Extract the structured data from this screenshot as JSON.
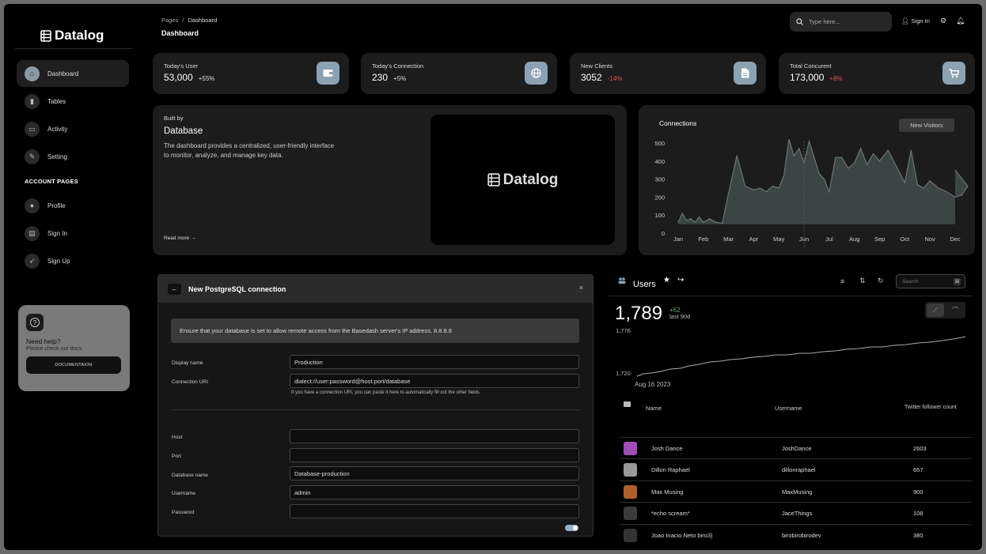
{
  "app": {
    "name": "Datalog"
  },
  "sidebar": {
    "items": [
      {
        "label": "Dashboard",
        "icon": "home-icon"
      },
      {
        "label": "Tables",
        "icon": "bar-chart-icon"
      },
      {
        "label": "Activity",
        "icon": "credit-card-icon"
      },
      {
        "label": "Setting",
        "icon": "wrench-icon"
      }
    ],
    "account_heading": "ACCOUNT PAGES",
    "account_items": [
      {
        "label": "Profile",
        "icon": "person-icon"
      },
      {
        "label": "Sign In",
        "icon": "document-icon"
      },
      {
        "label": "Sign Up",
        "icon": "rocket-icon"
      }
    ],
    "help": {
      "title": "Need help?",
      "subtitle": "Please check our docs",
      "button": "DOCUMENTAION"
    }
  },
  "header": {
    "breadcrumb_root": "Pages",
    "breadcrumb_sep": "/",
    "breadcrumb_current": "Dashboard",
    "title": "Dashboard",
    "search_placeholder": "Type here...",
    "sign_in": "Sign In"
  },
  "stats": [
    {
      "label": "Today's User",
      "value": "53,000",
      "change": "+55%",
      "color": "#dddddd",
      "icon": "wallet-icon"
    },
    {
      "label": "Today's Connection",
      "value": "230",
      "change": "+5%",
      "color": "#dddddd",
      "icon": "globe-icon"
    },
    {
      "label": "New Clients",
      "value": "3052",
      "change": "-14%",
      "color": "#e05252",
      "icon": "document-icon"
    },
    {
      "label": "Total Concurent",
      "value": "173,000",
      "change": "+8%",
      "color": "#e05252",
      "icon": "cart-icon"
    }
  ],
  "built": {
    "small": "Built by",
    "title": "Database",
    "description": "The dashboard provides a centralized, user-friendly interface to monitor, analyze, and manage key data.",
    "read_more": "Read more",
    "logo_text": "Datalog"
  },
  "connections": {
    "title": "Connections",
    "button": "New Visitors"
  },
  "chart_data": {
    "type": "area",
    "title": "Connections",
    "categories": [
      "Jan",
      "Feb",
      "Mar",
      "Apr",
      "May",
      "Jun",
      "Jul",
      "Aug",
      "Sep",
      "Oct",
      "Nov",
      "Dec"
    ],
    "yticks": [
      "500",
      "400",
      "300",
      "200",
      "100",
      "0"
    ],
    "ylim": [
      0,
      500
    ],
    "points": [
      [
        "Jan",
        60
      ],
      [
        "Jan",
        110
      ],
      [
        "Jan",
        70
      ],
      [
        "Jan",
        80
      ],
      [
        "Jan",
        60
      ],
      [
        "Jan",
        90
      ],
      [
        "Feb",
        60
      ],
      [
        "Feb",
        80
      ],
      [
        "Feb",
        60
      ],
      [
        "Feb",
        55
      ],
      [
        "Mar",
        220
      ],
      [
        "Mar",
        430
      ],
      [
        "Mar",
        260
      ],
      [
        "Apr",
        240
      ],
      [
        "Apr",
        250
      ],
      [
        "Apr",
        230
      ],
      [
        "Apr",
        260
      ],
      [
        "May",
        250
      ],
      [
        "May",
        320
      ],
      [
        "May",
        520
      ],
      [
        "May",
        430
      ],
      [
        "May",
        470
      ],
      [
        "Jun",
        390
      ],
      [
        "Jun",
        510
      ],
      [
        "Jun",
        420
      ],
      [
        "Jun",
        330
      ],
      [
        "Jun",
        300
      ],
      [
        "Jul",
        230
      ],
      [
        "Jul",
        420
      ],
      [
        "Jul",
        420
      ],
      [
        "Jul",
        360
      ],
      [
        "Aug",
        390
      ],
      [
        "Aug",
        470
      ],
      [
        "Aug",
        380
      ],
      [
        "Aug",
        440
      ],
      [
        "Sep",
        400
      ],
      [
        "Sep",
        460
      ],
      [
        "Sep",
        370
      ],
      [
        "Oct",
        280
      ],
      [
        "Oct",
        460
      ],
      [
        "Oct",
        270
      ],
      [
        "Oct",
        250
      ],
      [
        "Nov",
        290
      ],
      [
        "Nov",
        250
      ],
      [
        "Nov",
        230
      ],
      [
        "Dec",
        200
      ],
      [
        "Dec",
        210
      ],
      [
        "Dec",
        260
      ],
      [
        "Dec",
        350
      ]
    ]
  },
  "modal": {
    "title": "New PostgreSQL connection",
    "close": "×",
    "back": "←",
    "banner": "Ensure that your database is set to allow remote access from the Basedash server's IP address, 8.8.8.8",
    "fields": [
      {
        "label": "Display name",
        "value": "Production"
      },
      {
        "label": "Connection URI",
        "value": "dialect://user:password@host:port/database"
      },
      {
        "label": "Host",
        "value": ""
      },
      {
        "label": "Port",
        "value": ""
      },
      {
        "label": "Database name",
        "value": "Database-production"
      },
      {
        "label": "Username",
        "value": "admin"
      },
      {
        "label": "Password",
        "value": ""
      }
    ],
    "uri_help": "If you have a connection URI, you can paste it here to automatically fill out the other fields.",
    "toggle_on": true
  },
  "users": {
    "title": "Users",
    "search_placeholder": "Search",
    "search_key": "⌘",
    "count": "1,789",
    "delta": "+62",
    "delta_period": "last 90d",
    "y_high": "1,776",
    "y_low": "1,720",
    "date_label": "Aug 16 2023",
    "columns": [
      "Name",
      "Username",
      "Twitter follower count"
    ],
    "rows": [
      {
        "name": "Josh Dance",
        "username": "JoshDance",
        "followers": "2603",
        "avatar_color": "#a14db8"
      },
      {
        "name": "Dillon Raphael",
        "username": "dillonraphael",
        "followers": "657",
        "avatar_color": "#9a9a9a"
      },
      {
        "name": "Max Musing",
        "username": "MaxMusing",
        "followers": "900",
        "avatar_color": "#b0602a"
      },
      {
        "name": "*echo scream*",
        "username": "JaceThings",
        "followers": "108",
        "avatar_color": "#3a3a3a"
      },
      {
        "name": "Joao Inacio Neto biro3)",
        "username": "birobirobirodev",
        "followers": "380",
        "avatar_color": "#333333"
      }
    ]
  }
}
